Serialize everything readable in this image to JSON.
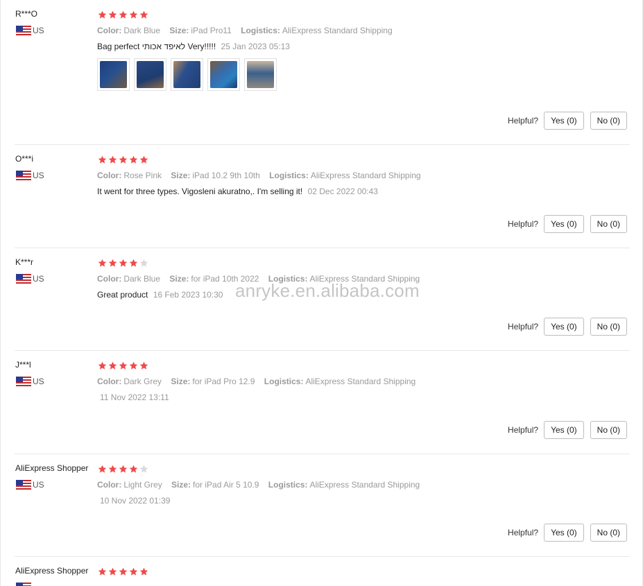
{
  "star_color": "#f04a4a",
  "star_empty_color": "#d9d9d9",
  "muted_color": "#9a9a9a",
  "watermark": "anryke.en.alibaba.com",
  "helpful_label": "Helpful?",
  "yes_label": "Yes (0)",
  "no_label": "No (0)",
  "meta_keys": {
    "color": "Color:",
    "size": "Size:",
    "logistics": "Logistics:"
  },
  "reviews": [
    {
      "user": "R***O",
      "country": "US",
      "rating": 5,
      "color": "Dark Blue",
      "size": "iPad Pro11",
      "logistics": "AliExpress Standard Shipping",
      "text": "Bag perfect לאיפד אכותי Very!!!!!",
      "date": "25 Jan 2023 05:13",
      "photos": [
        "photo-1",
        "photo-2",
        "photo-3",
        "photo-4",
        "photo-5"
      ]
    },
    {
      "user": "O***i",
      "country": "US",
      "rating": 5,
      "color": "Rose Pink",
      "size": "iPad 10.2 9th 10th",
      "logistics": "AliExpress Standard Shipping",
      "text": "It went for three types. Vigosleni akuratno,. I'm selling it!",
      "date": "02 Dec 2022 00:43",
      "photos": []
    },
    {
      "user": "K***r",
      "country": "US",
      "rating": 4,
      "color": "Dark Blue",
      "size": "for iPad 10th 2022",
      "logistics": "AliExpress Standard Shipping",
      "text": "Great product",
      "date": "16 Feb 2023 10:30",
      "photos": []
    },
    {
      "user": "J***l",
      "country": "US",
      "rating": 5,
      "color": "Dark Grey",
      "size": "for iPad Pro 12.9",
      "logistics": "AliExpress Standard Shipping",
      "text": "",
      "date": "11 Nov 2022 13:11",
      "photos": []
    },
    {
      "user": "AliExpress Shopper",
      "country": "US",
      "rating": 4,
      "color": "Light Grey",
      "size": "for iPad Air 5 10.9",
      "logistics": "AliExpress Standard Shipping",
      "text": "",
      "date": "10 Nov 2022 01:39",
      "photos": []
    },
    {
      "user": "AliExpress Shopper",
      "country": "US",
      "rating": 5,
      "color": "",
      "size": "",
      "logistics": "",
      "text": "",
      "date": "",
      "photos": []
    }
  ]
}
